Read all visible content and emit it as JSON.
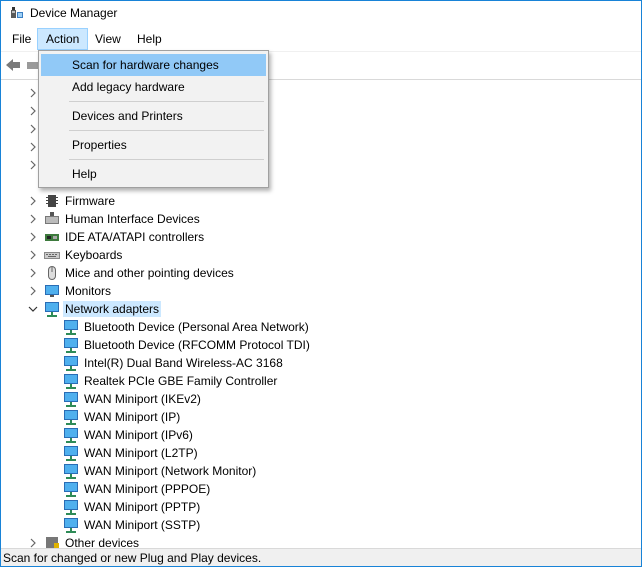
{
  "window": {
    "title": "Device Manager"
  },
  "menu": {
    "file": "File",
    "action": "Action",
    "view": "View",
    "help": "Help"
  },
  "action_menu": {
    "items": [
      "Scan for hardware changes",
      "Add legacy hardware",
      "Devices and Printers",
      "Properties",
      "Help"
    ]
  },
  "tree": {
    "categories": [
      {
        "label": "Firmware",
        "icon": "firmware-chip-icon",
        "expanded": false
      },
      {
        "label": "Human Interface Devices",
        "icon": "hid-keyboard-icon",
        "expanded": false
      },
      {
        "label": "IDE ATA/ATAPI controllers",
        "icon": "ide-controller-icon",
        "expanded": false
      },
      {
        "label": "Keyboards",
        "icon": "keyboard-icon",
        "expanded": false
      },
      {
        "label": "Mice and other pointing devices",
        "icon": "mouse-icon",
        "expanded": false
      },
      {
        "label": "Monitors",
        "icon": "monitor-icon",
        "expanded": false
      },
      {
        "label": "Network adapters",
        "icon": "network-adapter-icon",
        "expanded": true
      }
    ],
    "network_adapters": [
      "Bluetooth Device (Personal Area Network)",
      "Bluetooth Device (RFCOMM Protocol TDI)",
      "Intel(R) Dual Band Wireless-AC 3168",
      "Realtek PCIe GBE Family Controller",
      "WAN Miniport (IKEv2)",
      "WAN Miniport (IP)",
      "WAN Miniport (IPv6)",
      "WAN Miniport (L2TP)",
      "WAN Miniport (Network Monitor)",
      "WAN Miniport (PPPOE)",
      "WAN Miniport (PPTP)",
      "WAN Miniport (SSTP)"
    ],
    "after": [
      {
        "label": "Other devices",
        "icon": "other-devices-icon",
        "expanded": false
      }
    ]
  },
  "status": {
    "text": "Scan for changed or new Plug and Play devices."
  },
  "colors": {
    "accent": "#1883d7",
    "selection": "#cce8ff",
    "menu_hover": "#91c9f7"
  }
}
